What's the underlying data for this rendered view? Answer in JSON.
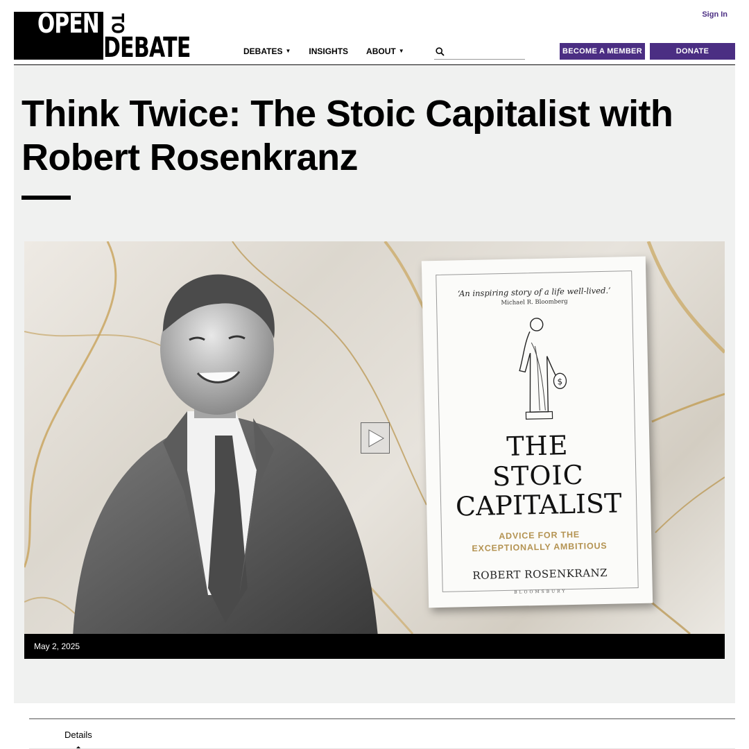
{
  "header": {
    "logo": {
      "word1": "OPEN",
      "word2": "TO",
      "word3": "DEBATE",
      "alt": "Open to Debate logo"
    },
    "sign_in": "Sign In",
    "nav": [
      {
        "label": "DEBATES",
        "has_dropdown": true
      },
      {
        "label": "INSIGHTS",
        "has_dropdown": false
      },
      {
        "label": "ABOUT",
        "has_dropdown": true
      }
    ],
    "search": {
      "value": "",
      "placeholder": "",
      "icon": "search-icon"
    },
    "become_member": "BECOME A MEMBER",
    "donate": "DONATE",
    "accent_color": "#4b2e83"
  },
  "page": {
    "title": "Think Twice: The Stoic Capitalist with Robert Rosenkranz",
    "date": "May 2, 2025"
  },
  "video": {
    "play_icon": "play-icon",
    "book": {
      "quote": "‘An inspiring story of a life well-lived.’",
      "quote_attribution": "Michael R. Bloomberg",
      "title_line1": "THE",
      "title_line2": "STOIC",
      "title_line3": "CAPITALIST",
      "subtitle_line1": "ADVICE FOR THE",
      "subtitle_line2": "EXCEPTIONALLY AMBITIOUS",
      "author": "ROBERT ROSENKRANZ",
      "publisher": "BLOOMSBURY"
    }
  },
  "tabs": [
    {
      "label": "Details",
      "active": true
    }
  ]
}
